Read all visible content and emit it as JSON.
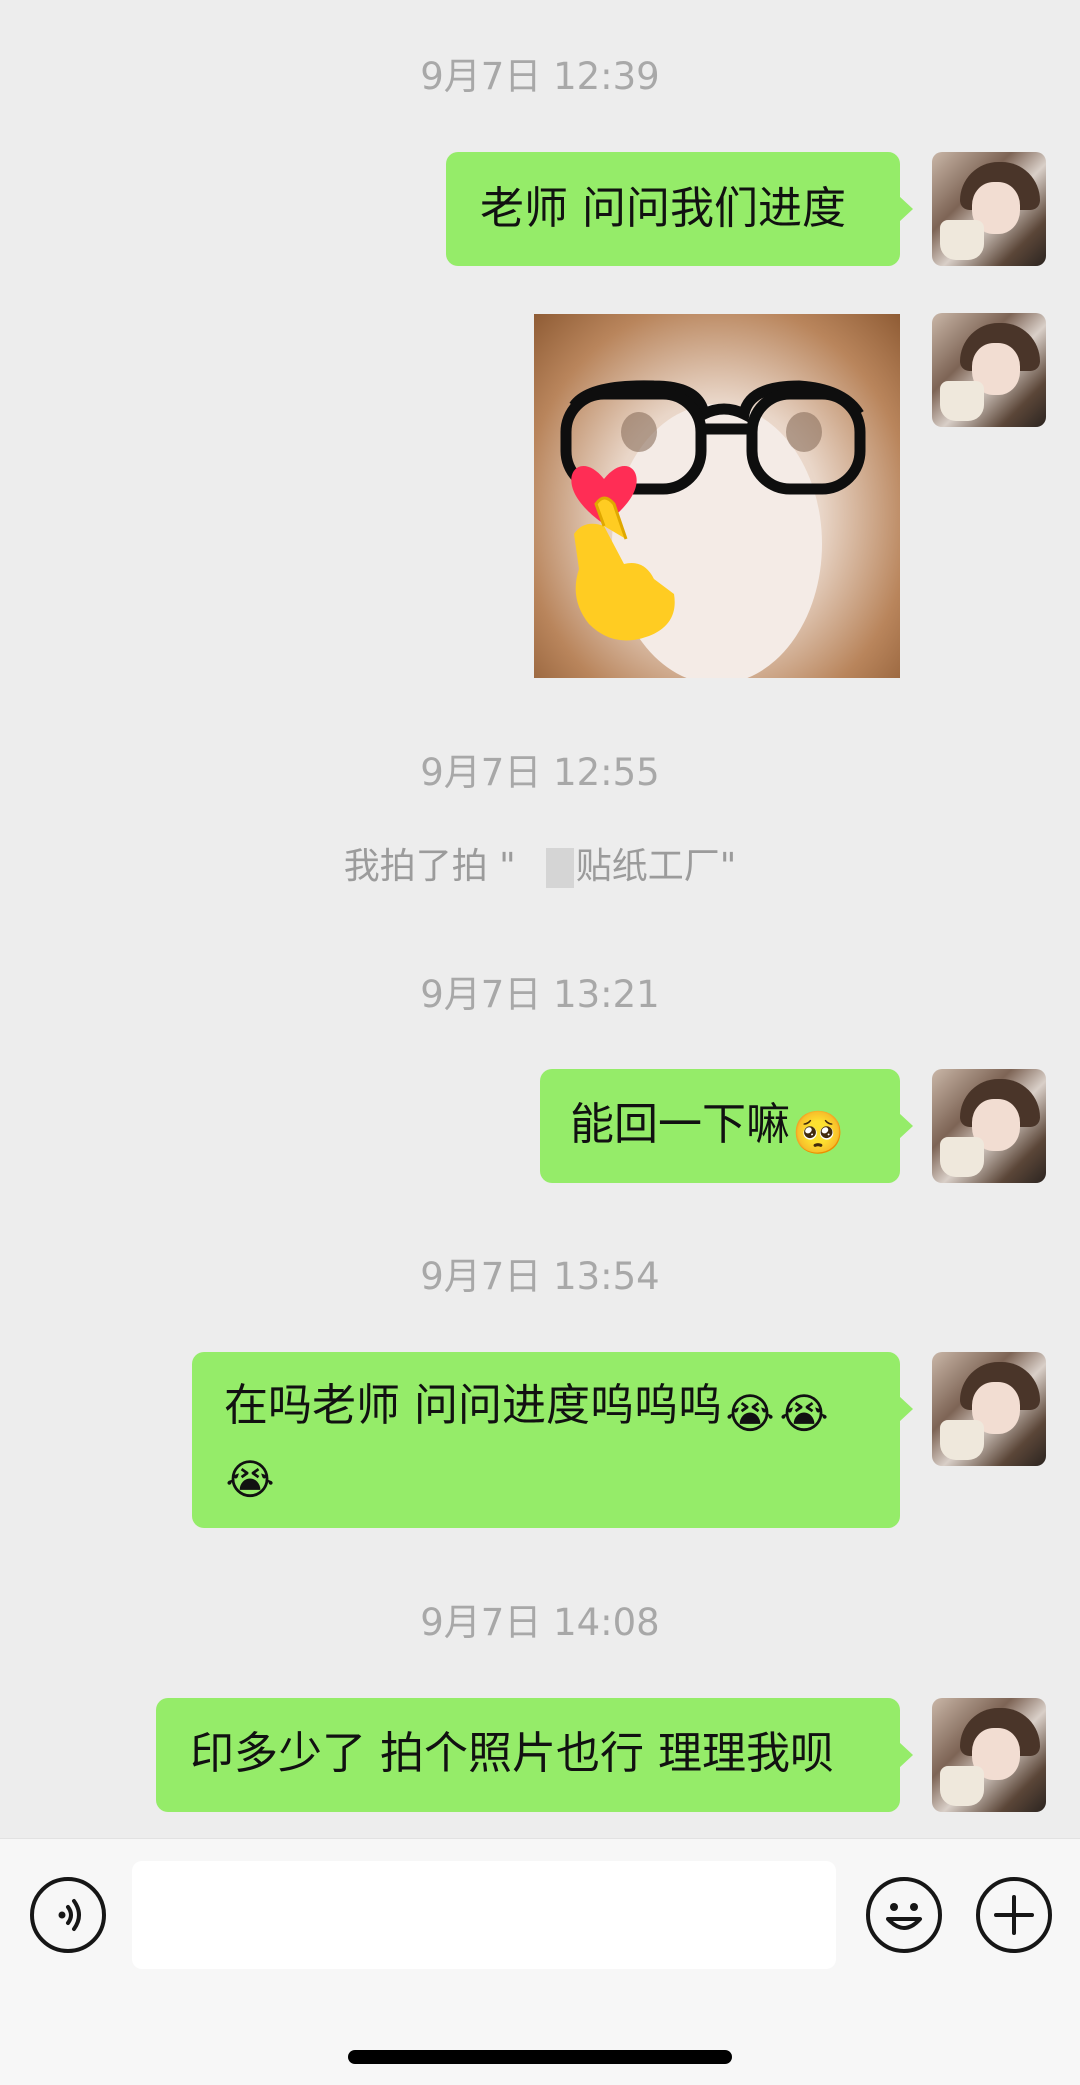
{
  "timestamps": [
    "9月7日 12:39",
    "9月7日 12:55",
    "9月7日 13:21",
    "9月7日 13:54",
    "9月7日 14:08"
  ],
  "system_message": {
    "before": "我拍了拍 \"",
    "after": "贴纸工厂\""
  },
  "messages": {
    "m1": "老师 问问我们进度",
    "m3": "能回一下嘛",
    "m4_line1": "在吗老师 问问进度呜呜呜",
    "m5": "印多少了 拍个照片也行 理理我呗"
  },
  "emoji": {
    "pleading": "🥺",
    "crying": "😭"
  },
  "colors": {
    "background": "#ededed",
    "bubble": "#95ec69",
    "timestamp": "#a8a8a8",
    "input_bar": "#f7f7f7"
  },
  "icons": {
    "voice": "voice-icon",
    "emoji": "emoji-icon",
    "plus": "plus-icon",
    "sticker": "glasses-cat-finger-heart-sticker"
  }
}
